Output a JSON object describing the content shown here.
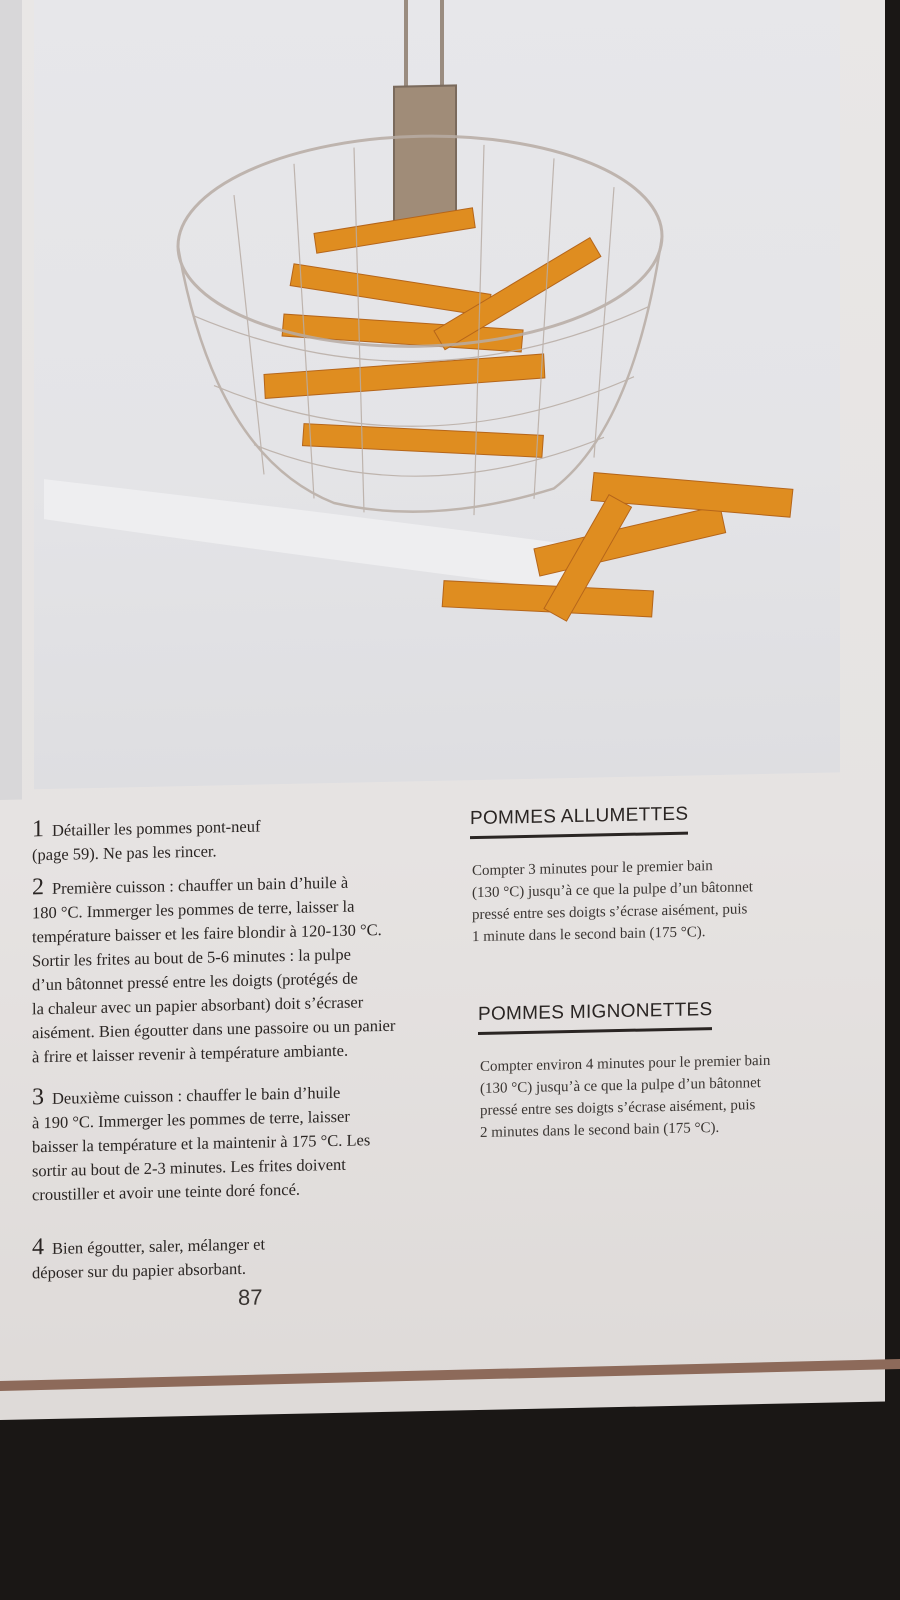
{
  "steps": [
    {
      "number": "1",
      "lines": [
        "Détailler les pommes pont-neuf",
        "(page 59). Ne pas les rincer."
      ]
    },
    {
      "number": "2",
      "lines": [
        "Première cuisson : chauffer un bain d’huile à",
        "180 °C. Immerger les pommes de terre, laisser la",
        "température baisser et les faire blondir à 120-130 °C.",
        "Sortir les frites au bout de 5-6 minutes : la pulpe",
        "d’un bâtonnet pressé entre les doigts (protégés de",
        "la chaleur avec un papier absorbant) doit s’écraser",
        "aisément. Bien égoutter dans une passoire ou un panier",
        "à frire et laisser revenir à température ambiante."
      ]
    },
    {
      "number": "3",
      "lines": [
        "Deuxième cuisson : chauffer le bain d’huile",
        "à 190 °C. Immerger les pommes de terre, laisser",
        "baisser la température et la maintenir à 175 °C. Les",
        "sortir au bout de 2-3 minutes. Les frites doivent",
        "croustiller et avoir une teinte doré foncé."
      ]
    },
    {
      "number": "4",
      "lines": [
        "Bien égoutter, saler, mélanger et",
        "déposer sur du papier absorbant."
      ]
    }
  ],
  "variants": [
    {
      "title": "POMMES ALLUMETTES",
      "lines": [
        "Compter 3 minutes pour le premier bain",
        "(130 °C) jusqu’à ce que la pulpe d’un bâtonnet",
        "pressé entre ses doigts s’écrase aisément, puis",
        "1 minute dans le second bain (175 °C)."
      ]
    },
    {
      "title": "POMMES MIGNONETTES",
      "lines": [
        "Compter environ 4 minutes pour le premier bain",
        "(130 °C) jusqu’à ce que la pulpe d’un bâtonnet",
        "pressé entre ses doigts s’écrase aisément, puis",
        "2 minutes dans le second bain (175 °C)."
      ]
    }
  ],
  "page_number": "87",
  "colors": {
    "text": "#2a2523",
    "fries": "#e0921c",
    "page": "#e8e6e5"
  }
}
